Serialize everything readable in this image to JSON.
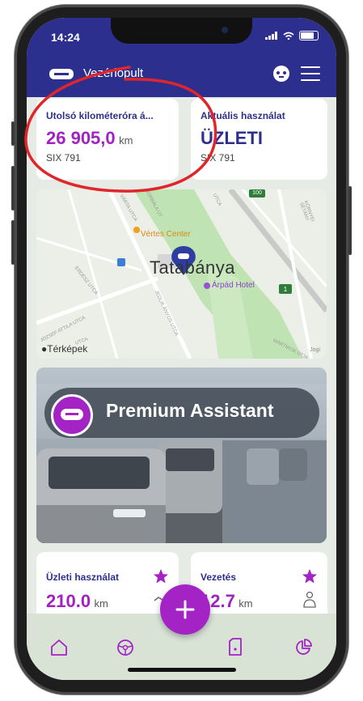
{
  "status_bar": {
    "time": "14:24"
  },
  "header": {
    "title": "Vezérlőpult"
  },
  "cards": {
    "odometer": {
      "label": "Utolsó kilométeróra á...",
      "value": "26 905,0",
      "unit": "km",
      "plate": "SIX 791"
    },
    "usage": {
      "label": "Aktuális használat",
      "value": "ÜZLETI",
      "plate": "SIX 791"
    }
  },
  "map": {
    "city": "Tatabánya",
    "pois": [
      "Vértes Center",
      "Árpád Hotel"
    ],
    "streets": [
      "ERDÉSZ UTCA",
      "JÓZSEF ATTILA UTCA",
      "VÁRTA UTCA",
      "SZENT BORBÁLA ÚT",
      "JEDLIK ÁNYOS UTCA",
      "MÁRTÍROK ÚTJA",
      "KÖRNYEI SÉTÁNY",
      "UTCA",
      "UTCA"
    ],
    "road_badges": [
      "100",
      "1"
    ],
    "attribution": "Térképek",
    "legal": "Jogi"
  },
  "promo": {
    "title": "Premium Assistant"
  },
  "bottom_cards": {
    "business": {
      "label": "Üzleti használat",
      "value": "210.0",
      "unit": "km"
    },
    "driving": {
      "label": "Vezetés",
      "value": "12.7",
      "unit": "km"
    }
  },
  "nav": {
    "items": [
      "home-icon",
      "steering-wheel-icon",
      "add-icon",
      "fuel-icon",
      "pie-chart-icon"
    ]
  },
  "colors": {
    "header": "#2d2f8e",
    "accent": "#a323c4",
    "annotation": "#e0262a"
  }
}
